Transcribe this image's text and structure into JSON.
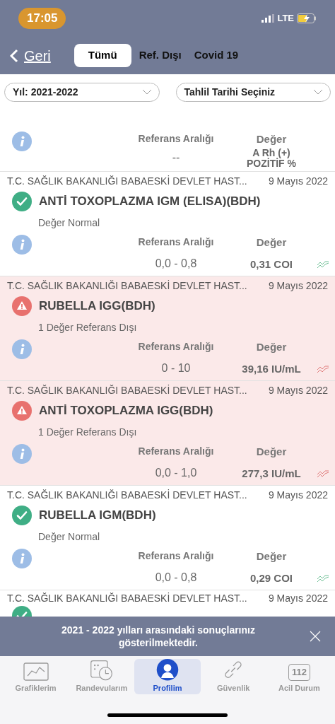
{
  "status_bar": {
    "time": "17:05",
    "network": "LTE"
  },
  "nav": {
    "back": "Geri",
    "tabs": [
      {
        "label": "Tümü",
        "selected": true
      },
      {
        "label": "Ref. Dışı",
        "selected": false
      },
      {
        "label": "Covid 19",
        "selected": false
      }
    ]
  },
  "filters": [
    {
      "value": "Yıl: 2021-2022"
    },
    {
      "value": "Tahlil Tarihi Seçiniz"
    }
  ],
  "summary": {
    "ref_label": "Referans Aralığı",
    "value_label": "Değer",
    "ref": "--",
    "value": "A Rh (+) POZİTİF %"
  },
  "results": [
    {
      "source": "T.C. SAĞLIK BAKANLIĞI BABAESKİ DEVLET HAST...",
      "date": "9 Mayıs 2022",
      "out_of_range": false,
      "title": "ANTİ TOXOPLAZMA IGM (ELISA)(BDH)",
      "note": "Değer Normal",
      "ref_label": "Referans Aralığı",
      "value_label": "Değer",
      "ref": "0,0 - 0,8",
      "value": "0,31 COI"
    },
    {
      "source": "T.C. SAĞLIK BAKANLIĞI BABAESKİ DEVLET HAST...",
      "date": "9 Mayıs 2022",
      "out_of_range": true,
      "title": "RUBELLA IGG(BDH)",
      "note": "1 Değer Referans Dışı",
      "ref_label": "Referans Aralığı",
      "value_label": "Değer",
      "ref": "0 - 10",
      "value": "39,16 IU/mL"
    },
    {
      "source": "T.C. SAĞLIK BAKANLIĞI BABAESKİ DEVLET HAST...",
      "date": "9 Mayıs 2022",
      "out_of_range": true,
      "title": "ANTİ TOXOPLAZMA IGG(BDH)",
      "note": "1 Değer Referans Dışı",
      "ref_label": "Referans Aralığı",
      "value_label": "Değer",
      "ref": "0,0 - 1,0",
      "value": "277,3 IU/mL"
    },
    {
      "source": "T.C. SAĞLIK BAKANLIĞI BABAESKİ DEVLET HAST...",
      "date": "9 Mayıs 2022",
      "out_of_range": false,
      "title": "RUBELLA IGM(BDH)",
      "note": "Değer Normal",
      "ref_label": "Referans Aralığı",
      "value_label": "Değer",
      "ref": "0,0 - 0,8",
      "value": "0,29 COI"
    },
    {
      "source": "T.C. SAĞLIK BAKANLIĞI BABAESKİ DEVLET HAST...",
      "date": "9 Mayıs 2022",
      "out_of_range": false
    }
  ],
  "toast": {
    "message": "2021 - 2022 yılları arasındaki sonuçlarınız gösterilmektedir."
  },
  "tab_bar": [
    {
      "kind": "chart",
      "label": "Grafiklerim",
      "selected": false
    },
    {
      "kind": "calendar",
      "label": "Randevularım",
      "selected": false
    },
    {
      "kind": "profile",
      "label": "Profilim",
      "selected": true
    },
    {
      "kind": "link",
      "label": "Güvenlik",
      "selected": false
    },
    {
      "kind": "emergency",
      "label": "Acil Durum",
      "badge": "112",
      "selected": false
    }
  ]
}
